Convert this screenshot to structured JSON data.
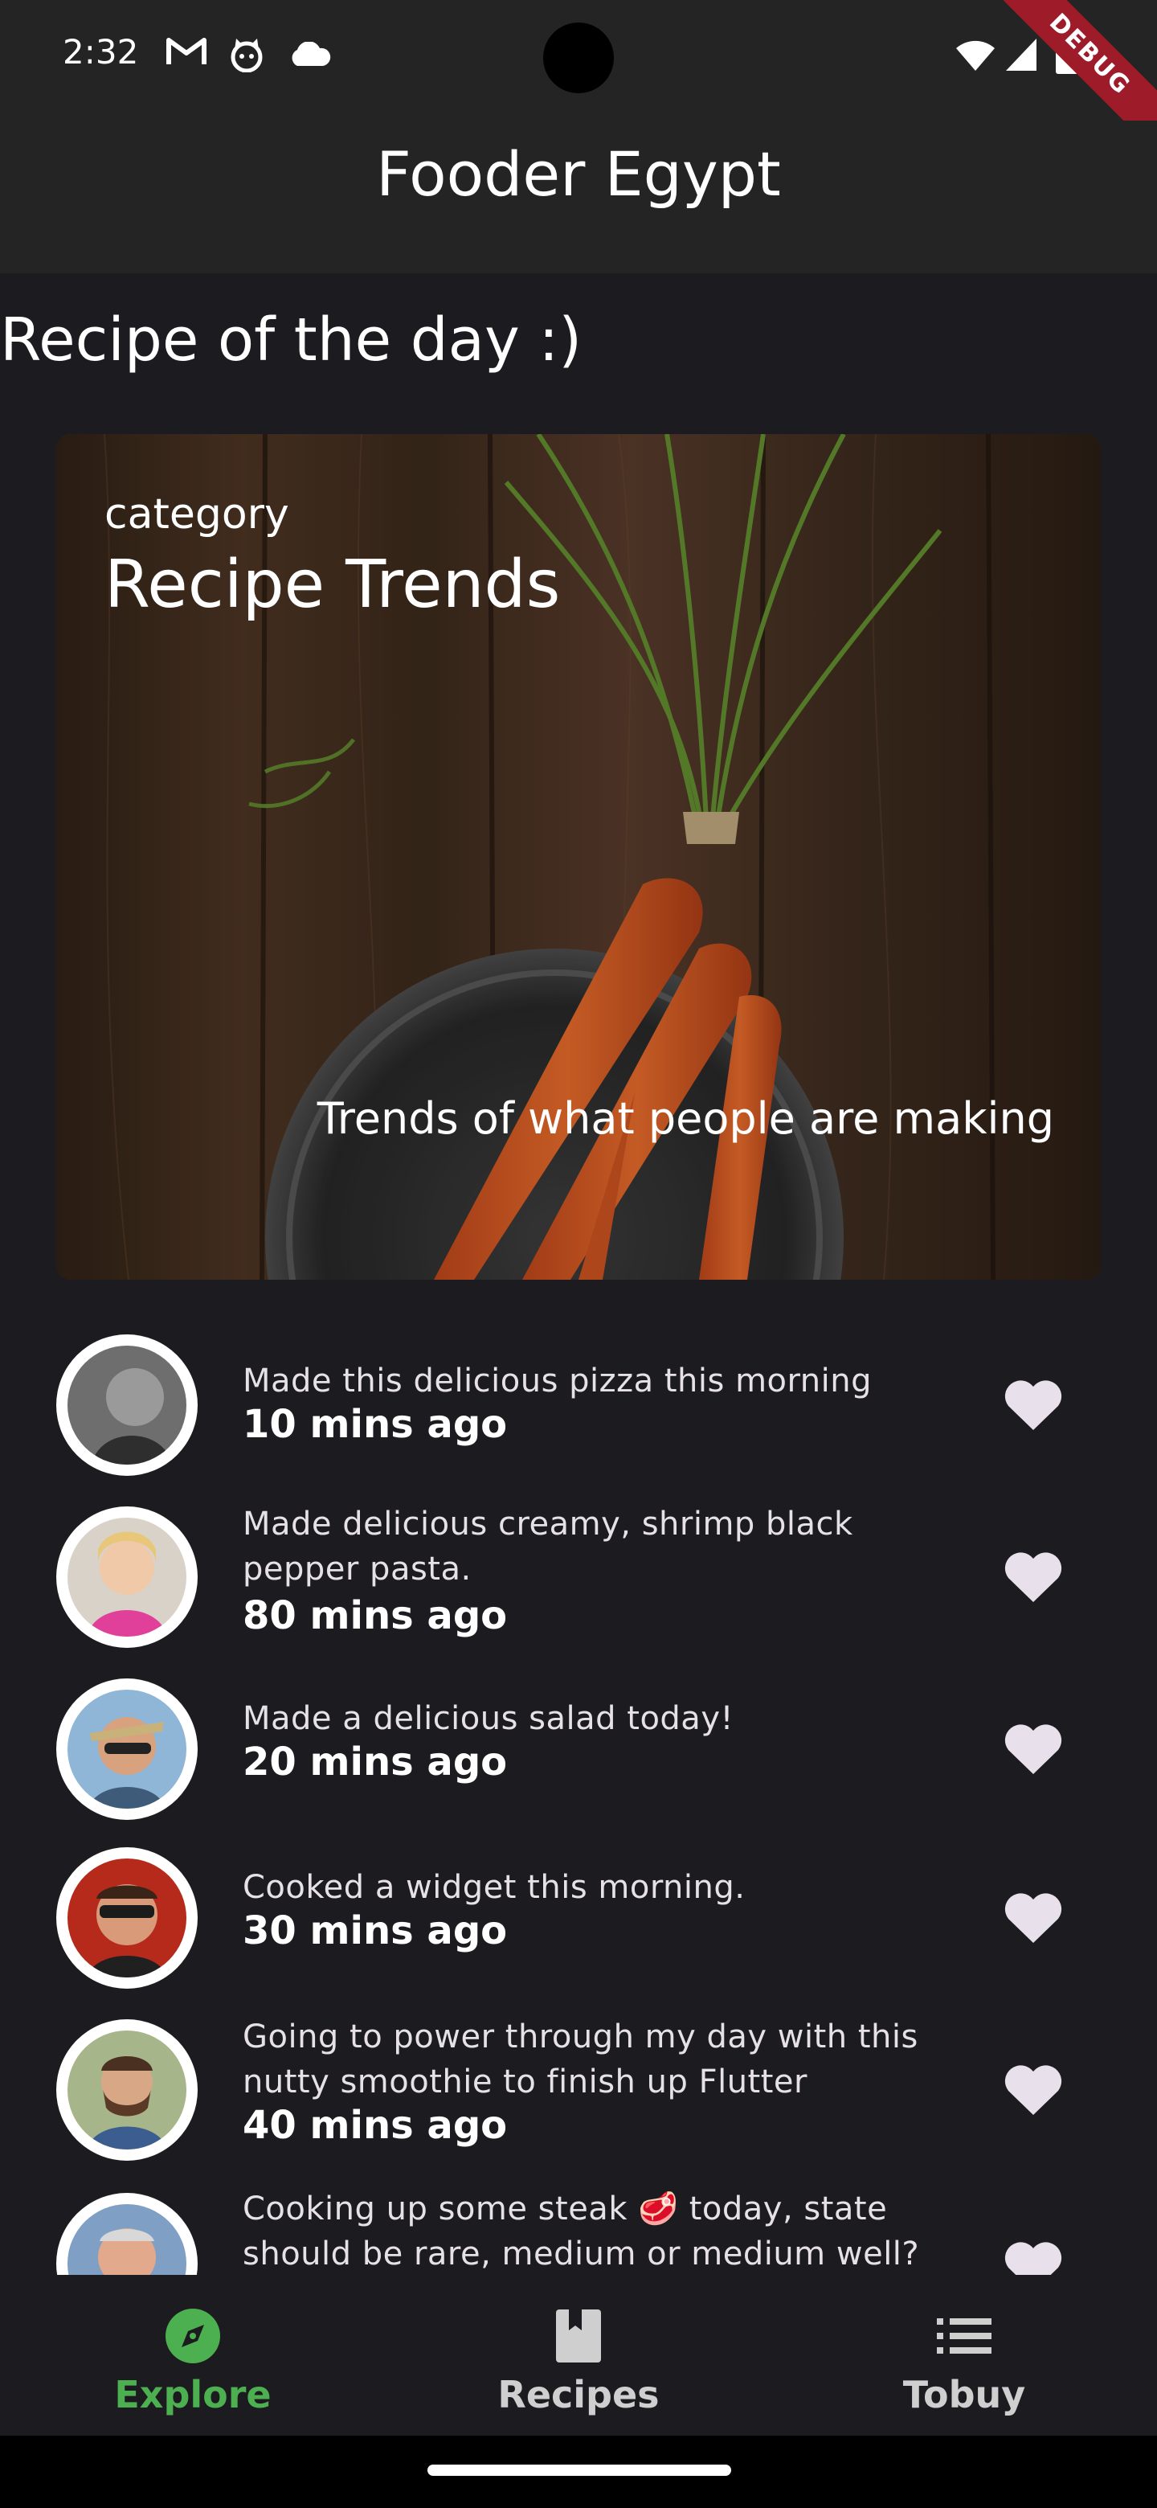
{
  "status_bar": {
    "time": "2:32",
    "icons": [
      "gmail-icon",
      "cat-notification-icon",
      "cloud-icon",
      "wifi-icon",
      "signal-icon",
      "battery-icon"
    ],
    "debug_banner": "DEBUG"
  },
  "app_bar": {
    "title": "Fooder Egypt"
  },
  "section": {
    "heading": "Recipe of the day :)"
  },
  "hero": {
    "category": "category",
    "title": "Recipe Trends",
    "subtitle": "Trends of what people are making"
  },
  "feed": [
    {
      "text": "Made this delicious pizza this morning",
      "time": "10 mins ago",
      "avatar": "person-1"
    },
    {
      "text": "Made delicious creamy, shrimp black pepper pasta.",
      "time": "80 mins ago",
      "avatar": "person-2"
    },
    {
      "text": "Made a delicious salad today!",
      "time": "20 mins ago",
      "avatar": "person-3"
    },
    {
      "text": "Cooked a widget this morning.",
      "time": "30 mins ago",
      "avatar": "person-4"
    },
    {
      "text": "Going to power through my day with this nutty smoothie to finish up Flutter",
      "time": "40 mins ago",
      "avatar": "person-5"
    },
    {
      "text": "Cooking up some steak 🥩 today, state should be rare, medium or medium well?",
      "time": "",
      "avatar": "person-6"
    }
  ],
  "bottom_nav": {
    "items": [
      {
        "label": "Explore",
        "icon": "compass-icon",
        "active": true
      },
      {
        "label": "Recipes",
        "icon": "book-icon",
        "active": false
      },
      {
        "label": "Tobuy",
        "icon": "list-icon",
        "active": false
      }
    ]
  },
  "colors": {
    "background": "#1c1b1f",
    "app_bar": "#242424",
    "accent": "#4caf50",
    "heart": "#e8e0ea"
  }
}
